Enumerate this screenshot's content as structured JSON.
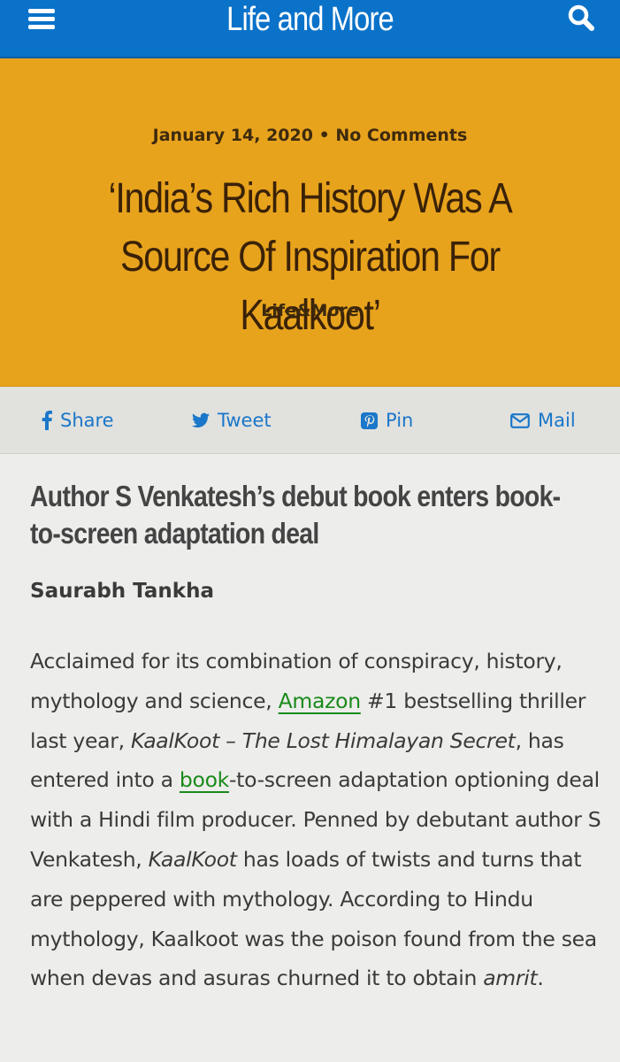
{
  "header": {
    "site_title": "Life and More",
    "menu_icon": "hamburger-menu-icon",
    "search_icon": "search-icon",
    "bar_color": "#0a72c9"
  },
  "hero": {
    "date": "January 14, 2020",
    "separator": "•",
    "comments": "No Comments",
    "title": "‘India’s Rich History Was A Source Of Inspiration For Kaalkoot’",
    "category": "Life&More",
    "background_color": "#e8a31d"
  },
  "share": {
    "facebook_label": "Share",
    "twitter_label": "Tweet",
    "pinterest_label": "Pin",
    "mail_label": "Mail",
    "accent_color": "#1a77c9"
  },
  "article": {
    "subtitle": "Author S Venkatesh’s debut book enters book-to-screen adaptation deal",
    "author": "Saurabh Tankha",
    "body": {
      "t1": "Acclaimed for its combination of conspiracy, history, mythology and science, ",
      "link_amazon": "Amazon",
      "t2": " #1 bestselling thriller last year, ",
      "em_title": "KaalKoot – The Lost Himalayan Secret",
      "t3": ", has entered into a ",
      "link_book": "book",
      "t4": "-to-screen adaptation optioning deal with a Hindi film producer. Penned by debutant author S Venkatesh, ",
      "em_kaalkoot": "KaalKoot",
      "t5": " has loads of twists and turns that are peppered with mythology. According to Hindu mythology, Kaalkoot was the poison found from the sea when devas and asuras churned it to obtain ",
      "em_amrit": "amrit",
      "t6": "."
    },
    "link_color": "#1a8a1a"
  }
}
